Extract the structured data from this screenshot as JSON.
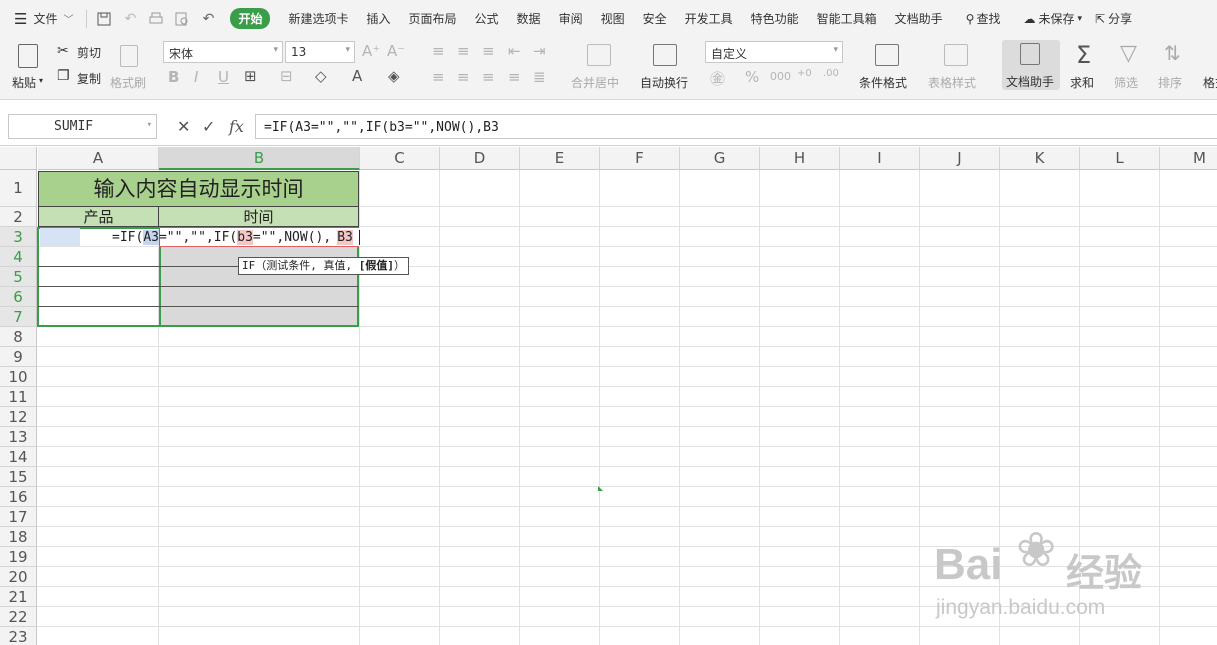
{
  "menubar": {
    "file_label": "文件",
    "tabs": [
      "开始",
      "新建选项卡",
      "插入",
      "页面布局",
      "公式",
      "数据",
      "审阅",
      "视图",
      "安全",
      "开发工具",
      "特色功能",
      "智能工具箱",
      "文档助手"
    ],
    "search_label": "查找",
    "unsaved_label": "未保存",
    "share_label": "分享"
  },
  "ribbon": {
    "paste_label": "粘贴",
    "cut_label": "剪切",
    "copy_label": "复制",
    "format_painter_label": "格式刷",
    "font_name": "宋体",
    "font_size": "13",
    "merge_label": "合并居中",
    "wrap_label": "自动换行",
    "number_format": "自定义",
    "conditional_format_label": "条件格式",
    "table_style_label": "表格样式",
    "doc_assistant_label": "文档助手",
    "sum_label": "求和",
    "filter_label": "筛选",
    "sort_label": "排序",
    "more_label": "格式"
  },
  "formula_bar": {
    "name_box": "SUMIF",
    "formula": "=IF(A3=\"\",\"\",IF(b3=\"\",NOW(),B3"
  },
  "sheet": {
    "columns": [
      "A",
      "B",
      "C",
      "D",
      "E",
      "F",
      "G",
      "H",
      "I",
      "J",
      "K",
      "L",
      "M"
    ],
    "rows": [
      "1",
      "2",
      "3",
      "4",
      "5",
      "6",
      "7",
      "8",
      "9",
      "10",
      "11",
      "12",
      "13",
      "14",
      "15",
      "16",
      "17",
      "18",
      "19",
      "20",
      "21",
      "22",
      "23"
    ],
    "title_cell": "输入内容自动显示时间",
    "header_product": "产品",
    "header_time": "时间",
    "editing_formula": {
      "p1": "=IF(",
      "ref1": "A3",
      "p2": "=\"\",\"\",IF(",
      "ref2": "b3",
      "p3": "=\"\",NOW(),",
      "ref3": "B3"
    },
    "tooltip": {
      "text": "IF（测试条件, 真值, ",
      "bold": "[假值]",
      "end": "）"
    },
    "colors": {
      "title_fill": "#a9d18e",
      "header_fill": "#c5e0b4",
      "selected_fill": "#d9d9d9",
      "accent": "#3a9d4a"
    }
  },
  "watermark": {
    "brand": "Bai",
    "brand2": "经验",
    "url": "jingyan.baidu.com"
  }
}
